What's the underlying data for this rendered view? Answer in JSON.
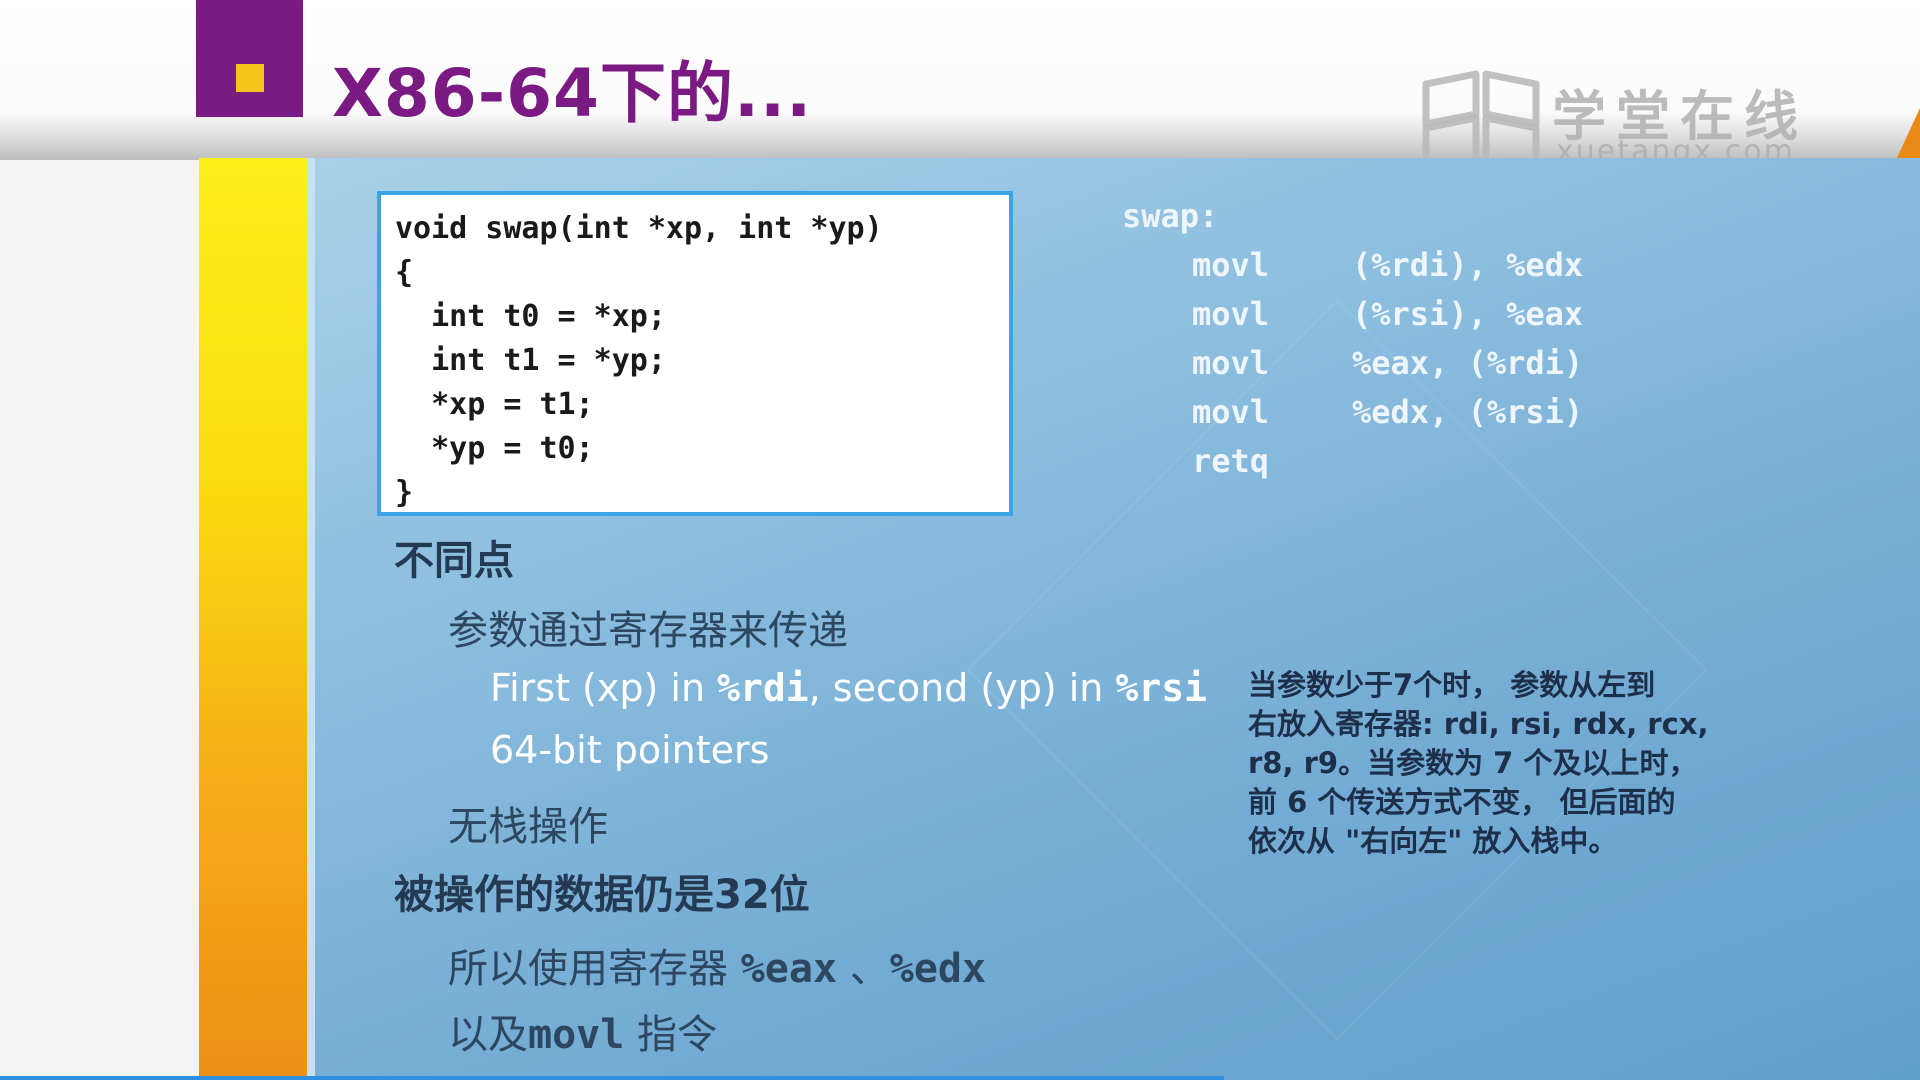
{
  "title": "X86-64下的...",
  "watermark": {
    "name": "学堂在线",
    "url": "xuetangx.com"
  },
  "code": {
    "lines": [
      "void swap(int *xp, int *yp)",
      "{",
      "  int t0 = *xp;",
      "  int t1 = *yp;",
      "  *xp = t1;",
      "  *yp = t0;",
      "}"
    ]
  },
  "assembly": {
    "label": "swap:",
    "instructions": [
      {
        "op": "movl",
        "args": "(%rdi), %edx"
      },
      {
        "op": "movl",
        "args": "(%rsi), %eax"
      },
      {
        "op": "movl",
        "args": "%eax, (%rdi)"
      },
      {
        "op": "movl",
        "args": "%edx, (%rsi)"
      },
      {
        "op": "retq",
        "args": ""
      }
    ]
  },
  "bullets": {
    "differences_heading": "不同点",
    "pass_by_registers": "参数通过寄存器来传递",
    "first_arg_text": "First (xp) in ",
    "first_arg_reg": "%rdi",
    "second_arg_text": ", second (yp) in ",
    "second_arg_reg": "%rsi",
    "pointers": "64-bit pointers",
    "no_stack": "无栈操作",
    "data_32bit": "被操作的数据仍是32位",
    "use_regs_text": "所以使用寄存器 ",
    "use_regs_reg1": "%eax",
    "use_regs_sep": " 、",
    "use_regs_reg2": "%edx",
    "movl_prefix": "以及",
    "movl_code": "movl",
    "movl_suffix": " 指令"
  },
  "note": {
    "lines": [
      "当参数少于7个时， 参数从左到",
      "右放入寄存器: rdi, rsi, rdx, rcx,",
      "r8, r9。当参数为 7 个及以上时，",
      "前 6 个传送方式不变， 但后面的",
      "依次从 \"右向左\" 放入栈中。"
    ]
  },
  "colors": {
    "title_purple": "#7a1a82",
    "marker_yellow": "#f7c21a",
    "panel_blue": "#8fc0e0",
    "code_border": "#3aa4e4",
    "strip_yellow": "#fdee1c",
    "strip_orange": "#ec8f16"
  }
}
